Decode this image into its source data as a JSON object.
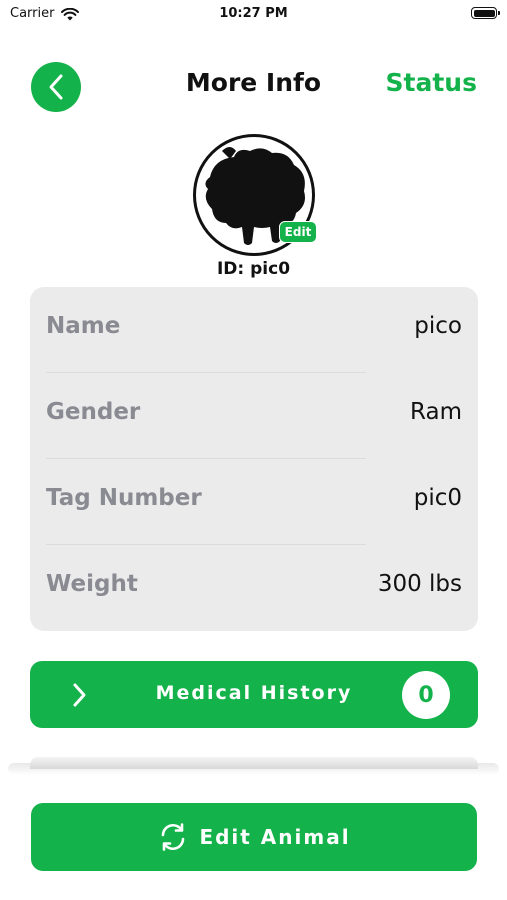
{
  "status_bar": {
    "carrier": "Carrier",
    "time": "10:27 PM"
  },
  "header": {
    "title": "More Info",
    "status_link": "Status"
  },
  "animal": {
    "edit_badge": "Edit",
    "id_text": "ID: pic0"
  },
  "info": {
    "rows": [
      {
        "label": "Name",
        "value": "pico"
      },
      {
        "label": "Gender",
        "value": "Ram"
      },
      {
        "label": "Tag Number",
        "value": "pic0"
      },
      {
        "label": "Weight",
        "value": "300 lbs"
      }
    ]
  },
  "medical": {
    "label": "Medical History",
    "count": "0"
  },
  "actions": {
    "edit_label": "Edit Animal"
  },
  "colors": {
    "accent": "#14b24a",
    "card_bg": "#ebebeb",
    "label_gray": "#8a8a92"
  },
  "icons": {
    "back": "chevron-left-icon",
    "expand": "chevron-right-icon",
    "edit": "refresh-icon",
    "wifi": "wifi-icon",
    "battery": "battery-icon"
  }
}
